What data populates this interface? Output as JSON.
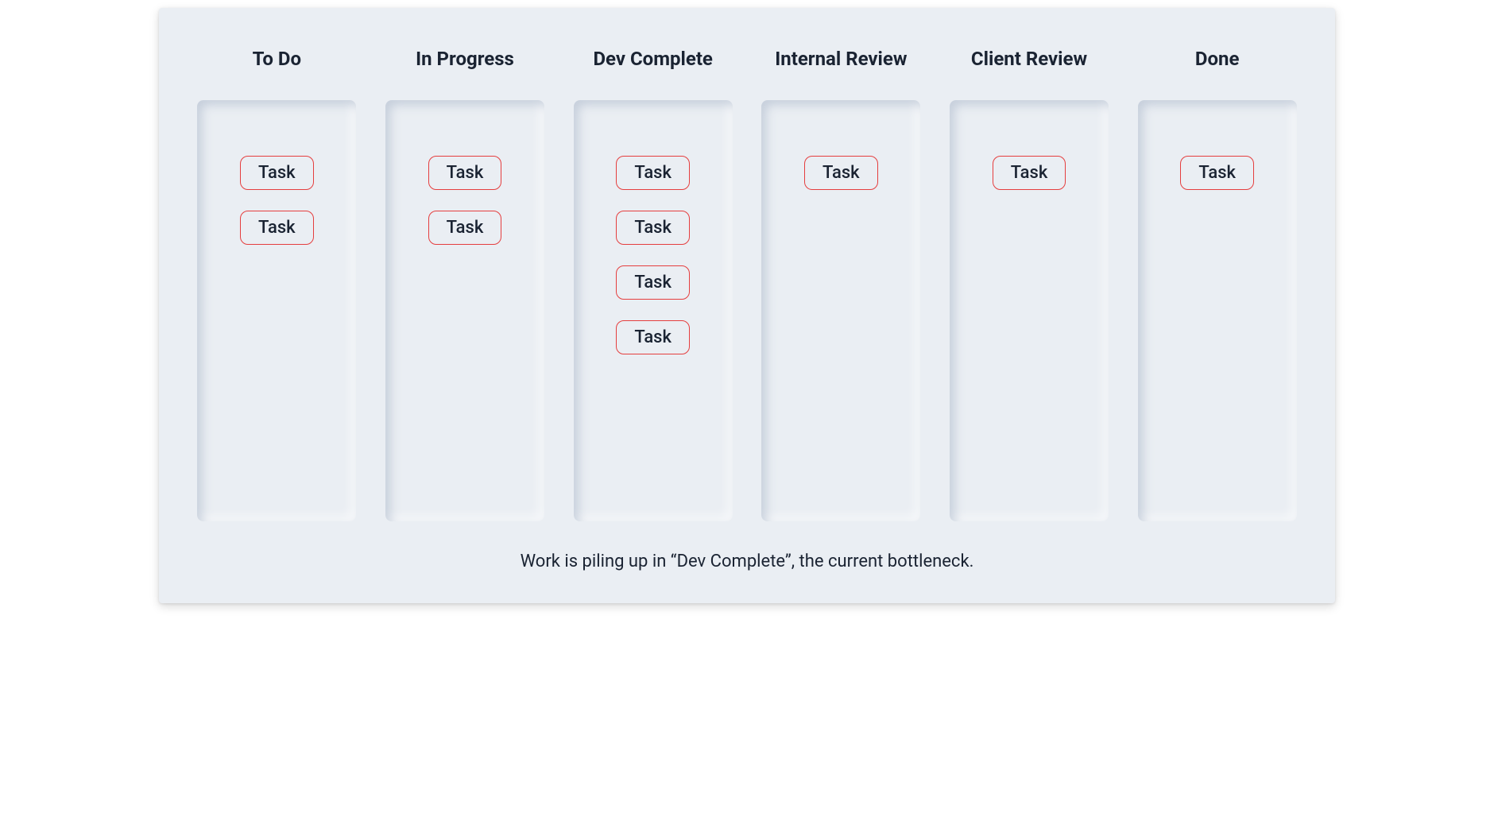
{
  "board": {
    "columns": [
      {
        "title": "To Do",
        "tasks": [
          "Task",
          "Task"
        ]
      },
      {
        "title": "In Progress",
        "tasks": [
          "Task",
          "Task"
        ]
      },
      {
        "title": "Dev Complete",
        "tasks": [
          "Task",
          "Task",
          "Task",
          "Task"
        ]
      },
      {
        "title": "Internal Review",
        "tasks": [
          "Task"
        ]
      },
      {
        "title": "Client Review",
        "tasks": [
          "Task"
        ]
      },
      {
        "title": "Done",
        "tasks": [
          "Task"
        ]
      }
    ],
    "caption": "Work is piling up in “Dev Complete”, the current bottleneck."
  },
  "colors": {
    "background": "#eaeef3",
    "text": "#1a2332",
    "task_border": "#e53e3e"
  }
}
